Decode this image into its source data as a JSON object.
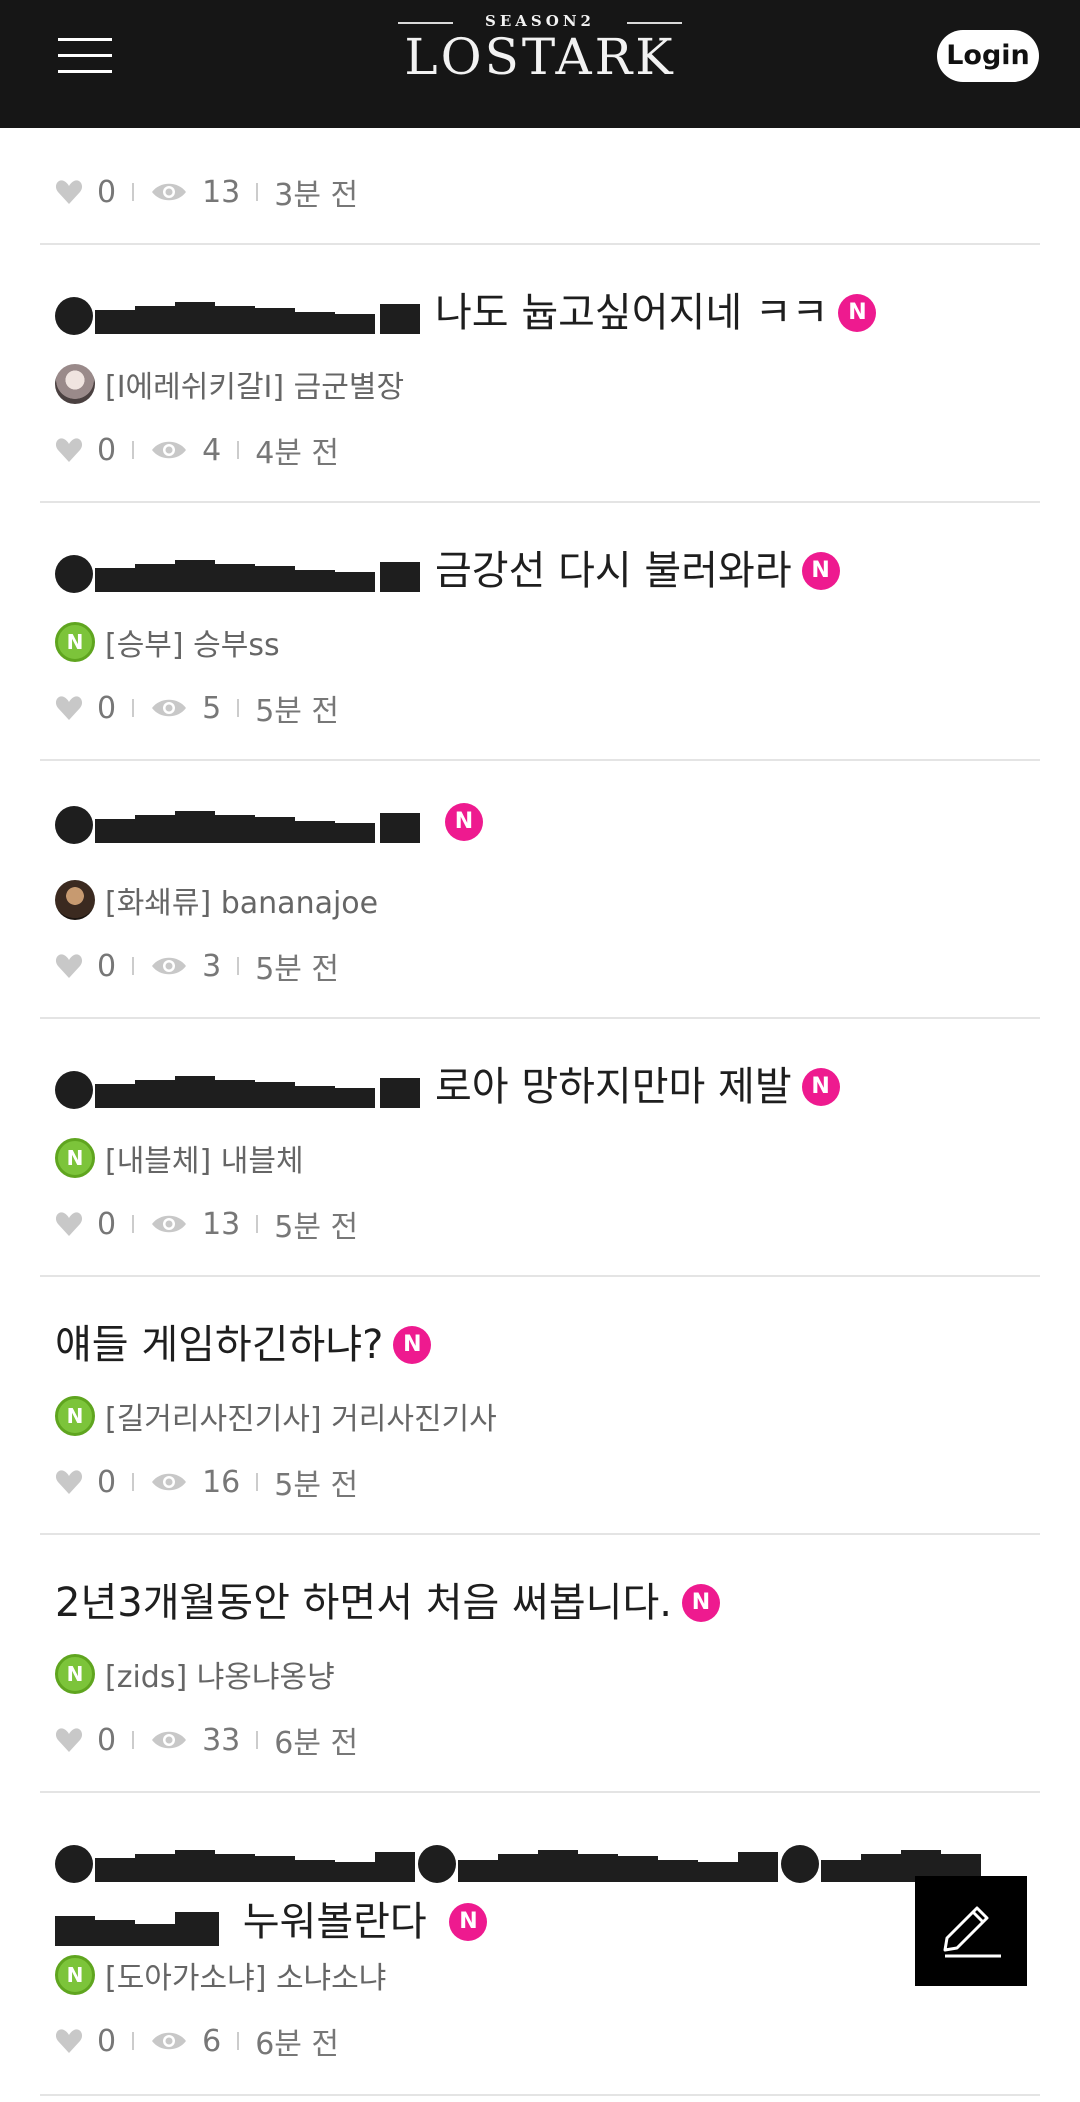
{
  "header": {
    "logo_season": "SEASON2",
    "logo_main": "LOSTARK",
    "login_label": "Login"
  },
  "badge_label": "N",
  "posts": [
    {
      "title_text": "",
      "author": "",
      "likes": "0",
      "views": "13",
      "time": "3분 전"
    },
    {
      "title_text": "나도 늅고싶어지네 ㅋㅋ",
      "author": "[I에레쉬키갈I] 금군별장",
      "likes": "0",
      "views": "4",
      "time": "4분 전"
    },
    {
      "title_text": "금강선 다시 불러와라",
      "author": "[승부] 승부ss",
      "likes": "0",
      "views": "5",
      "time": "5분 전"
    },
    {
      "title_text": "",
      "author": "[화쇄류] bananajoe",
      "likes": "0",
      "views": "3",
      "time": "5분 전"
    },
    {
      "title_text": "로아 망하지만마 제발",
      "author": "[내블체] 내블체",
      "likes": "0",
      "views": "13",
      "time": "5분 전"
    },
    {
      "title_text": "얘들 게임하긴하냐?",
      "author": "[길거리사진기사] 거리사진기사",
      "likes": "0",
      "views": "16",
      "time": "5분 전"
    },
    {
      "title_text": "2년3개월동안 하면서 처음 써봅니다.",
      "author": "[zids] 냐옹냐옹냥",
      "likes": "0",
      "views": "33",
      "time": "6분 전"
    },
    {
      "title_text": "누워볼란다",
      "author": "[도아가소냐] 소냐소냐",
      "likes": "0",
      "views": "6",
      "time": "6분 전"
    }
  ],
  "colors": {
    "header_bg": "#161616",
    "badge": "#ee1a8f",
    "avatar_green": "#7cc43a",
    "write_button_bg": "#000000"
  },
  "icons": [
    "menu-icon",
    "heart-icon",
    "eye-icon",
    "pencil-icon"
  ]
}
